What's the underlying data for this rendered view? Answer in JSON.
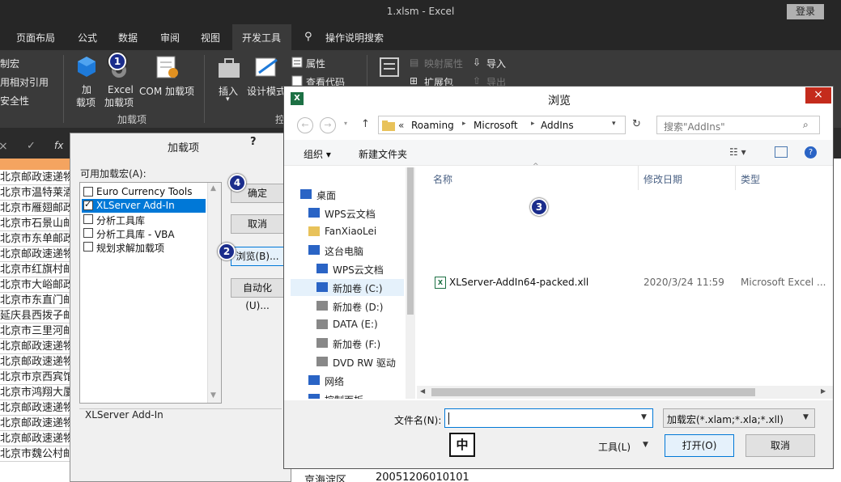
{
  "window": {
    "title": "1.xlsm  -  Excel",
    "login": "登录"
  },
  "tabs": [
    "页面布局",
    "公式",
    "数据",
    "审阅",
    "视图",
    "开发工具",
    "操作说明搜索"
  ],
  "ribbon": {
    "macro_items": [
      "录制宏",
      "使用相对引用",
      "宏安全性"
    ],
    "addins_big": [
      "加",
      "载项",
      "Excel",
      "加载项",
      "COM 加载项"
    ],
    "addins_group": "加载项",
    "controls": {
      "insert": "插入",
      "design": "设计模式",
      "props": "属性",
      "view_code": "查看代码",
      "group_partial": "控"
    },
    "xml": {
      "map_props": "映射属性",
      "import": "导入",
      "ext_pack": "扩展包",
      "export": "导出"
    }
  },
  "formula_bar": {
    "cancel": "×",
    "confirm": "✓",
    "fx": "fx"
  },
  "sheet": {
    "rows": [
      "北京邮政速递物",
      "北京市温特莱酒",
      "北京市雁翅邮政",
      "北京市石景山邮",
      "北京市东单邮政",
      "北京邮政速递物",
      "北京市红旗村邮",
      "北京市大峪邮政",
      "北京市东直门邮",
      "延庆县西拨子邮",
      "北京市三里河邮",
      "北京邮政速递物",
      "北京邮政速递物",
      "北京市京西宾馆",
      "北京市鸿翔大厦",
      "北京邮政速递物",
      "北京邮政速递物",
      "北京邮政速递物",
      "北京市魏公村邮"
    ],
    "bottom_cells": [
      "京海淀区",
      "20051206010101"
    ]
  },
  "addins_dialog": {
    "title": "加载项",
    "help": "?",
    "list_label": "可用加载宏(A):",
    "items": [
      {
        "label": "Euro Currency Tools",
        "checked": false
      },
      {
        "label": "XLServer Add-In",
        "checked": true
      },
      {
        "label": "分析工具库",
        "checked": false
      },
      {
        "label": "分析工具库 - VBA",
        "checked": false
      },
      {
        "label": "规划求解加载项",
        "checked": false
      }
    ],
    "ok": "确定",
    "cancel": "取消",
    "browse": "浏览(B)...",
    "automation": "自动化(U)...",
    "desc_title": "XLServer Add-In"
  },
  "browse_dialog": {
    "title": "浏览",
    "close": "×",
    "breadcrumb": [
      "«",
      "Roaming",
      "Microsoft",
      "AddIns"
    ],
    "search_placeholder": "搜索\"AddIns\"",
    "organize": "组织 ▾",
    "new_folder": "新建文件夹",
    "nav": [
      "桌面",
      "WPS云文档",
      "FanXiaoLei",
      "这台电脑",
      "WPS云文档",
      "新加卷 (C:)",
      "新加卷 (D:)",
      "DATA (E:)",
      "新加卷 (F:)",
      "DVD RW 驱动",
      "网络",
      "控制面板"
    ],
    "columns": [
      "名称",
      "修改日期",
      "类型"
    ],
    "file": {
      "name": "XLServer-AddIn64-packed.xll",
      "date": "2020/3/24 11:59",
      "type": "Microsoft Excel ..."
    },
    "filename_label": "文件名(N):",
    "filename_value": "",
    "filter": "加载宏(*.xlam;*.xla;*.xll)",
    "tools": "工具(L)",
    "open": "打开(O)",
    "cancel": "取消",
    "ime": "中"
  },
  "steps": [
    "1",
    "2",
    "3",
    "4"
  ]
}
